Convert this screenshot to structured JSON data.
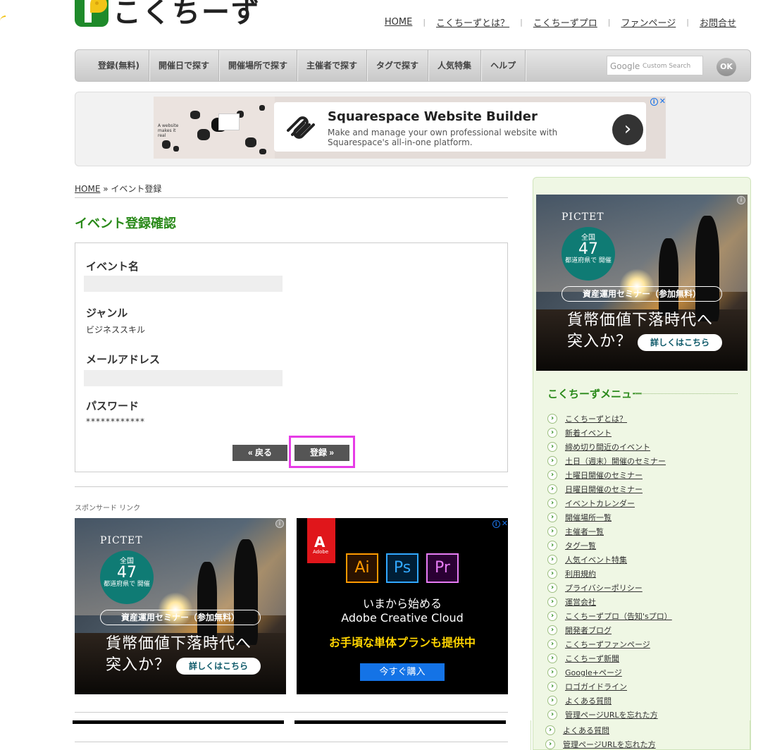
{
  "site": {
    "logo_text": "こくちーず"
  },
  "top_links": [
    "HOME",
    "こくちーずとは？",
    "こくちーずプロ",
    "ファンページ",
    "お問合せ"
  ],
  "nav": {
    "items": [
      "登録(無料)",
      "開催日で探す",
      "開催場所で探す",
      "主催者で探す",
      "タグで探す",
      "人気特集",
      "ヘルプ"
    ],
    "search_brand": "Google",
    "search_placeholder": "Custom Search",
    "search_button": "OK"
  },
  "top_ad": {
    "title": "Squarespace Website Builder",
    "description": "Make and manage your own professional website with Squarespace's all-in-one platform.",
    "image_text": "A website makes it real"
  },
  "breadcrumb": {
    "home": "HOME",
    "sep": "»",
    "current": "イベント登録"
  },
  "page_title": "イベント登録確認",
  "form": {
    "event_name_label": "イベント名",
    "event_name_value": "",
    "genre_label": "ジャンル",
    "genre_value": "ビジネススキル",
    "email_label": "メールアドレス",
    "email_value": "",
    "password_label": "パスワード",
    "password_value": "************",
    "back_button": "« 戻る",
    "register_button": "登録 »"
  },
  "sponsored_label": "スポンサード リンク",
  "pictet_ad": {
    "brand": "PICTET",
    "circle_top": "全国",
    "circle_number": "47",
    "circle_bottom": "都道府県で 開催",
    "pill": "資産運用セミナー（参加無料）",
    "headline1": "貨幣価値下落時代へ",
    "headline2": "突入か？",
    "more": "詳しくはこちら"
  },
  "adobe_ad": {
    "logo": "Adobe",
    "apps": [
      "Ai",
      "Ps",
      "Pr"
    ],
    "line1": "いまから始める",
    "line2": "Adobe Creative Cloud",
    "line3": "お手頃な単体プランも提供中",
    "cta": "今すぐ購入"
  },
  "sidebar": {
    "menu_title": "こくちーずメニュー",
    "items": [
      "こくちーずとは？",
      "新着イベント",
      "締め切り間近のイベント",
      "土日（週末）開催のセミナー",
      "土曜日開催のセミナー",
      "日曜日開催のセミナー",
      "イベントカレンダー",
      "開催場所一覧",
      "主催者一覧",
      "タグ一覧",
      "人気イベント特集",
      "利用規約",
      "プライバシーポリシー",
      "運営会社",
      "こくちーずプロ（告知'sプロ）",
      "開発者ブログ",
      "こくちーずファンページ",
      "こくちーず新聞",
      "Google+ページ",
      "ロゴガイドライン",
      "よくある質問",
      "管理ページURLを忘れた方"
    ],
    "overflow_items": [
      "よくある質問",
      "管理ページURLを忘れた方"
    ]
  },
  "colors": {
    "brand_green": "#2a8a1a",
    "highlight": "#e63ce6",
    "button_dark": "#555555"
  }
}
